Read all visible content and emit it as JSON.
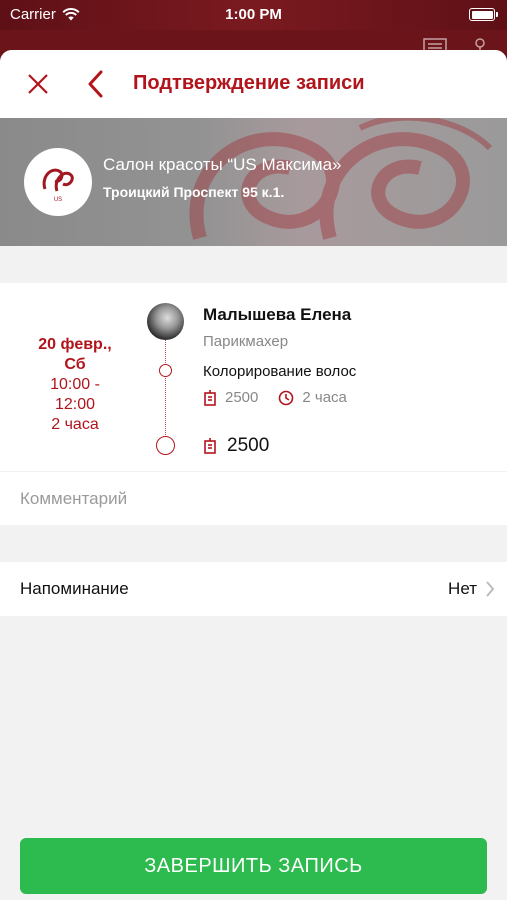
{
  "status_bar": {
    "carrier": "Carrier",
    "time": "1:00 PM"
  },
  "nav": {
    "title": "Подтверждение записи"
  },
  "salon": {
    "name": "Салон красоты “US Максима»",
    "address": "Троицкий Проспект 95 к.1.",
    "logo_text": "US"
  },
  "booking": {
    "date_line1": "20 февр.,",
    "date_line2": "Сб",
    "time_line1": "10:00 -",
    "time_line2": "12:00",
    "duration": "2 часа",
    "master_name": "Малышева Елена",
    "master_role": "Парикмахер",
    "service_name": "Колорирование волос",
    "service_price": "2500",
    "service_duration": "2 часа",
    "total": "2500"
  },
  "comment": {
    "placeholder": "Комментарий"
  },
  "reminder": {
    "label": "Напоминание",
    "value": "Нет"
  },
  "actions": {
    "complete_label": "ЗАВЕРШИТЬ ЗАПИСЬ"
  },
  "colors": {
    "accent": "#b2141c",
    "button": "#2dba4e",
    "header_bg": "#6b1419"
  },
  "icons": {
    "close": "close-icon",
    "back": "chevron-left-icon",
    "wifi": "wifi-icon",
    "battery": "battery-icon",
    "price": "price-tag-icon",
    "clock": "clock-icon",
    "chevron": "chevron-right-icon"
  }
}
